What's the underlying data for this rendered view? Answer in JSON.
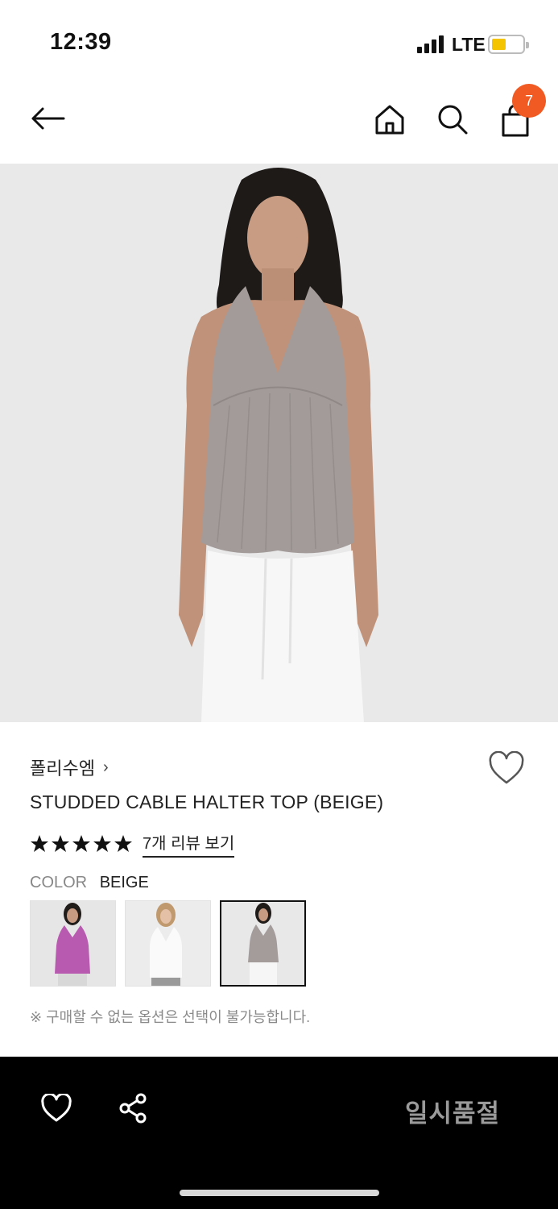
{
  "status_bar": {
    "time": "12:39",
    "network": "LTE",
    "battery_level": 0.35,
    "battery_color": "#f5c400"
  },
  "nav": {
    "back_icon": "arrow-left-icon",
    "home_icon": "home-icon",
    "search_icon": "search-icon",
    "cart_icon": "shopping-bag-icon",
    "cart_count": "7",
    "badge_color": "#f15a22"
  },
  "product": {
    "brand": "폴리수엠",
    "brand_chevron": "›",
    "title": "STUDDED CABLE HALTER TOP (BEIGE)",
    "rating_stars": 5,
    "review_link": "7개 리뷰 보기",
    "color_label": "COLOR",
    "color_value": "BEIGE",
    "swatches": [
      {
        "name": "pink",
        "color": "#b85bb0",
        "selected": false
      },
      {
        "name": "white",
        "color": "#f4f4f4",
        "selected": false
      },
      {
        "name": "beige",
        "color": "#a39c9a",
        "selected": true
      }
    ],
    "notice": "※ 구매할 수 없는 옵션은 선택이 불가능합니다."
  },
  "bottom_bar": {
    "wishlist_icon": "heart-icon",
    "share_icon": "share-icon",
    "status_label": "일시품절"
  }
}
